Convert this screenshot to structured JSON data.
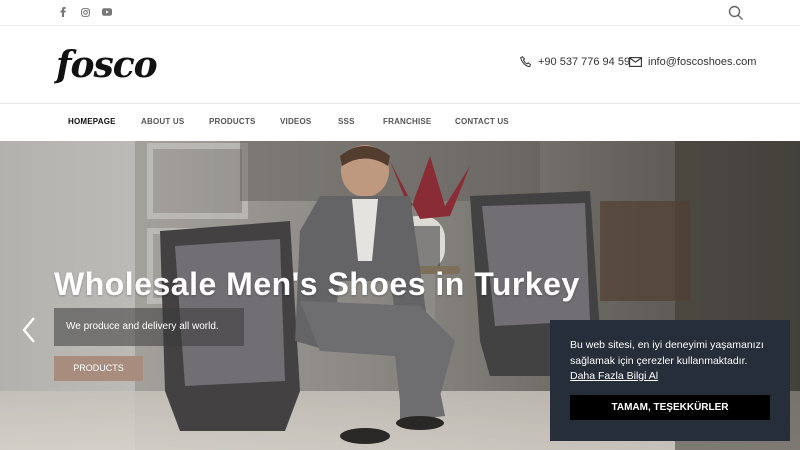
{
  "topbar": {
    "social": [
      {
        "icon": "facebook-icon"
      },
      {
        "icon": "instagram-icon"
      },
      {
        "icon": "youtube-icon"
      }
    ],
    "search_icon": "search-icon"
  },
  "header": {
    "logo_text": "fosco",
    "phone": "+90 537 776 94 59",
    "email": "info@foscoshoes.com"
  },
  "nav": {
    "items": [
      {
        "label": "HOMEPAGE",
        "active": true
      },
      {
        "label": "ABOUT US"
      },
      {
        "label": "PRODUCTS"
      },
      {
        "label": "VIDEOS"
      },
      {
        "label": "SSS"
      },
      {
        "label": "FRANCHISE"
      },
      {
        "label": "CONTACT US"
      }
    ]
  },
  "hero": {
    "title": "Wholesale Men's Shoes in Turkey",
    "subtitle": "We produce and delivery all world.",
    "button_label": "PRODUCTS"
  },
  "cookie": {
    "text": "Bu web sitesi, en iyi deneyimi yaşamanızı sağlamak için çerezler kullanmaktadır.",
    "link": "Daha Fazla Bilgi Al",
    "button": "TAMAM, TEŞEKKÜRLER"
  },
  "colors": {
    "accent_button": "#a88d7e",
    "cookie_bg": "#252e39"
  }
}
